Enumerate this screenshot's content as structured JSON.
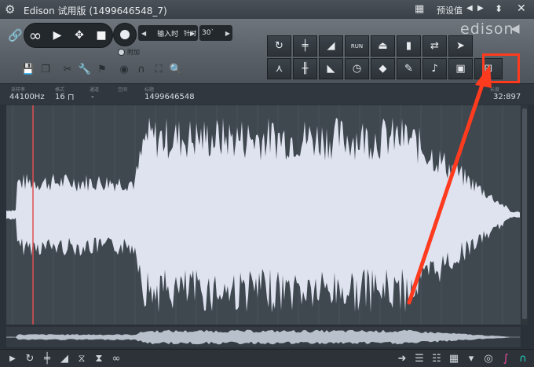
{
  "titlebar": {
    "title": "Edison 试用版 (1499646548_7)",
    "presets_label": "预设值"
  },
  "transport": {
    "input_label": "输入时",
    "mode_label": "针对",
    "mode_value": "30`",
    "attach_label": "附加"
  },
  "brand": {
    "logo_text": "edison"
  },
  "info": {
    "sample_rate_label": "采样率",
    "sample_rate": "44100Hz",
    "format_label": "格式",
    "bit_depth": "16",
    "channels_label": "通道",
    "channels_value": "-",
    "blank_label": "空间",
    "title_label": "标题",
    "title_value": "1499646548",
    "length_label": "长度",
    "length_value": "32:897"
  },
  "grid_buttons_row1": [
    "refresh-icon",
    "normalize-icon",
    "fade-in-icon",
    "run-icon",
    "rocket-icon",
    "equalizer-icon",
    "reverse-icon",
    "cursor-icon"
  ],
  "grid_buttons_row2": [
    "tune-icon",
    "spectrum-icon",
    "fade-out-icon",
    "clock-icon",
    "drop-icon",
    "pen-icon",
    "note-icon",
    "save-icon",
    "export-icon"
  ],
  "colors": {
    "accent": "#ff3b1f",
    "waveform": "#dfe3f0",
    "background": "#3f474f"
  }
}
